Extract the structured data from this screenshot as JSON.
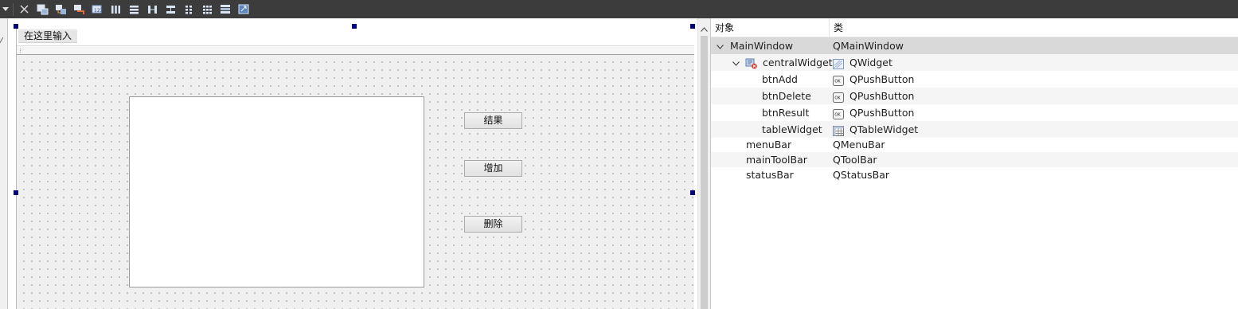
{
  "toolbar": {
    "buttons": [
      {
        "name": "dropdown-arrow-icon"
      },
      {
        "name": "close-icon"
      },
      {
        "name": "edit-widgets-icon"
      },
      {
        "name": "edit-signals-slots-icon"
      },
      {
        "name": "edit-buddies-icon"
      },
      {
        "name": "edit-tab-order-icon"
      },
      {
        "name": "layout-horizontal-icon"
      },
      {
        "name": "layout-vertical-icon"
      },
      {
        "name": "layout-horizontal-splitter-icon"
      },
      {
        "name": "layout-vertical-splitter-icon"
      },
      {
        "name": "layout-form-icon"
      },
      {
        "name": "layout-grid-icon"
      },
      {
        "name": "break-layout-icon"
      },
      {
        "name": "adjust-size-icon"
      }
    ]
  },
  "form": {
    "menu_placeholder": "在这里输入",
    "buttons": {
      "result": "结果",
      "add": "增加",
      "delete": "删除"
    }
  },
  "inspector": {
    "headers": {
      "object": "对象",
      "class": "类"
    },
    "rows": [
      {
        "object": "MainWindow",
        "class": "QMainWindow",
        "icon": "none",
        "class_icon": "none"
      },
      {
        "object": "centralWidget",
        "class": "QWidget",
        "icon": "widget-broken-layout-icon",
        "class_icon": "qwidget-icon"
      },
      {
        "object": "btnAdd",
        "class": "QPushButton",
        "icon": "none",
        "class_icon": "pushbutton-icon"
      },
      {
        "object": "btnDelete",
        "class": "QPushButton",
        "icon": "none",
        "class_icon": "pushbutton-icon"
      },
      {
        "object": "btnResult",
        "class": "QPushButton",
        "icon": "none",
        "class_icon": "pushbutton-icon"
      },
      {
        "object": "tableWidget",
        "class": "QTableWidget",
        "icon": "none",
        "class_icon": "tablewidget-icon"
      },
      {
        "object": "menuBar",
        "class": "QMenuBar",
        "icon": "none",
        "class_icon": "none"
      },
      {
        "object": "mainToolBar",
        "class": "QToolBar",
        "icon": "none",
        "class_icon": "none"
      },
      {
        "object": "statusBar",
        "class": "QStatusBar",
        "icon": "none",
        "class_icon": "none"
      }
    ]
  },
  "colors": {
    "toolbar_bg": "#3c3c3c",
    "selection_handle": "#000080",
    "selected_row": "#d9d9d9"
  }
}
